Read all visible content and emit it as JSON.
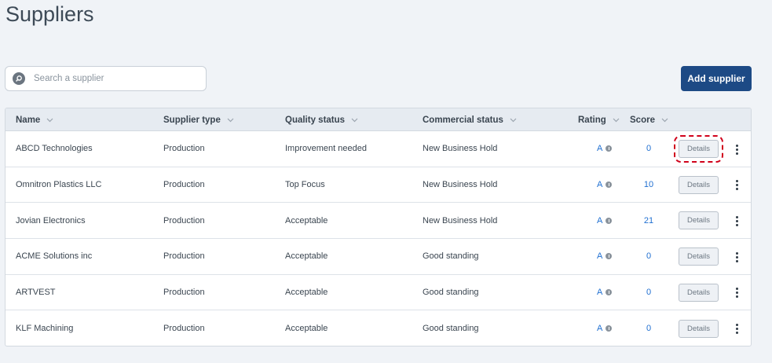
{
  "page": {
    "title": "Suppliers"
  },
  "search": {
    "placeholder": "Search a supplier"
  },
  "toolbar": {
    "add_label": "Add supplier"
  },
  "table": {
    "columns": [
      {
        "key": "name",
        "label": "Name"
      },
      {
        "key": "supplier_type",
        "label": "Supplier type"
      },
      {
        "key": "quality_status",
        "label": "Quality status"
      },
      {
        "key": "commercial_status",
        "label": "Commercial status"
      },
      {
        "key": "rating",
        "label": "Rating"
      },
      {
        "key": "score",
        "label": "Score"
      }
    ],
    "details_label": "Details",
    "rows": [
      {
        "name": "ABCD Technologies",
        "supplier_type": "Production",
        "quality_status": "Improvement needed",
        "commercial_status": "New Business Hold",
        "rating": "A",
        "score": "0",
        "highlighted": true
      },
      {
        "name": "Omnitron Plastics LLC",
        "supplier_type": "Production",
        "quality_status": "Top Focus",
        "commercial_status": "New Business Hold",
        "rating": "A",
        "score": "10"
      },
      {
        "name": "Jovian Electronics",
        "supplier_type": "Production",
        "quality_status": "Acceptable",
        "commercial_status": "New Business Hold",
        "rating": "A",
        "score": "21"
      },
      {
        "name": "ACME Solutions inc",
        "supplier_type": "Production",
        "quality_status": "Acceptable",
        "commercial_status": "Good standing",
        "rating": "A",
        "score": "0"
      },
      {
        "name": "ARTVEST",
        "supplier_type": "Production",
        "quality_status": "Acceptable",
        "commercial_status": "Good standing",
        "rating": "A",
        "score": "0"
      },
      {
        "name": "KLF Machining",
        "supplier_type": "Production",
        "quality_status": "Acceptable",
        "commercial_status": "Good standing",
        "rating": "A",
        "score": "0"
      }
    ]
  },
  "colors": {
    "background": "#f0f3f7",
    "primary_button": "#1d4a85",
    "link": "#1f6fd1",
    "highlight_outline": "#d0021b"
  },
  "icons": {
    "search": "search-icon",
    "sort": "chevron-down-icon",
    "info": "info-icon",
    "more": "kebab-menu-icon"
  }
}
